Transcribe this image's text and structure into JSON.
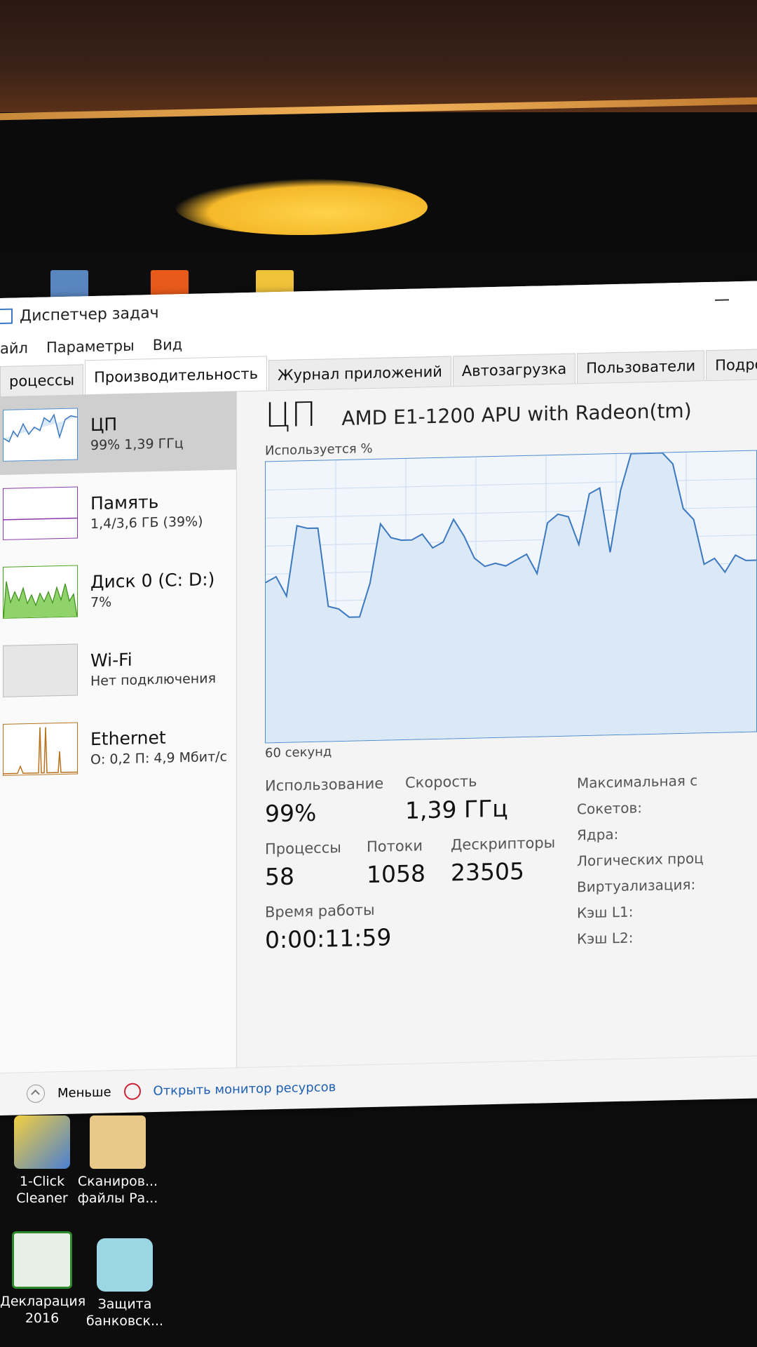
{
  "window": {
    "title": "Диспетчер задач",
    "menu": [
      "айл",
      "Параметры",
      "Вид"
    ],
    "tabs": [
      "роцессы",
      "Производительность",
      "Журнал приложений",
      "Автозагрузка",
      "Пользователи",
      "Подроб"
    ]
  },
  "sidebar": [
    {
      "name": "ЦП",
      "sub": "99% 1,39 ГГц",
      "color": "#4d8ccf"
    },
    {
      "name": "Память",
      "sub": "1,4/3,6 ГБ (39%)",
      "color": "#8a3aa8"
    },
    {
      "name": "Диск 0 (C: D:)",
      "sub": "7%",
      "color": "#4aa420"
    },
    {
      "name": "Wi-Fi",
      "sub": "Нет подключения",
      "color": "#bbbbbb"
    },
    {
      "name": "Ethernet",
      "sub": "О: 0,2 П: 4,9 Мбит/с",
      "color": "#b8721e"
    }
  ],
  "cpu": {
    "title": "ЦП",
    "model": "AMD E1-1200 APU with Radeon(tm)",
    "graph_label": "Используется %",
    "time_label": "60 секунд",
    "usage_pct": [
      57,
      59,
      52,
      77,
      76,
      76,
      48,
      47,
      44,
      44,
      56,
      77,
      72,
      71,
      71,
      73,
      68,
      70,
      78,
      72,
      64,
      61,
      62,
      61,
      63,
      65,
      58,
      76,
      79,
      78,
      68,
      86,
      88,
      65,
      87,
      100,
      100,
      100,
      100,
      96,
      80,
      76,
      60,
      62,
      57,
      63,
      61,
      61
    ],
    "stats": {
      "usage": {
        "label": "Использование",
        "value": "99%"
      },
      "speed": {
        "label": "Скорость",
        "value": "1,39 ГГц"
      },
      "processes": {
        "label": "Процессы",
        "value": "58"
      },
      "threads": {
        "label": "Потоки",
        "value": "1058"
      },
      "handles": {
        "label": "Дескрипторы",
        "value": "23505"
      },
      "uptime": {
        "label": "Время работы",
        "value": "0:00:11:59"
      }
    },
    "info_labels": [
      "Максимальная с",
      "Сокетов:",
      "Ядра:",
      "Логических проц",
      "Виртуализация:",
      "Кэш L1:",
      "Кэш L2:"
    ]
  },
  "footer": {
    "less": "Меньше",
    "monitor": "Открыть монитор ресурсов"
  },
  "desktop_icons": [
    {
      "label1": "1-Click",
      "label2": "Cleaner"
    },
    {
      "label1": "Сканиров...",
      "label2": "файлы Ра..."
    },
    {
      "label1": "Декларация",
      "label2": "2016"
    },
    {
      "label1": "Защита",
      "label2": "банковск..."
    }
  ]
}
